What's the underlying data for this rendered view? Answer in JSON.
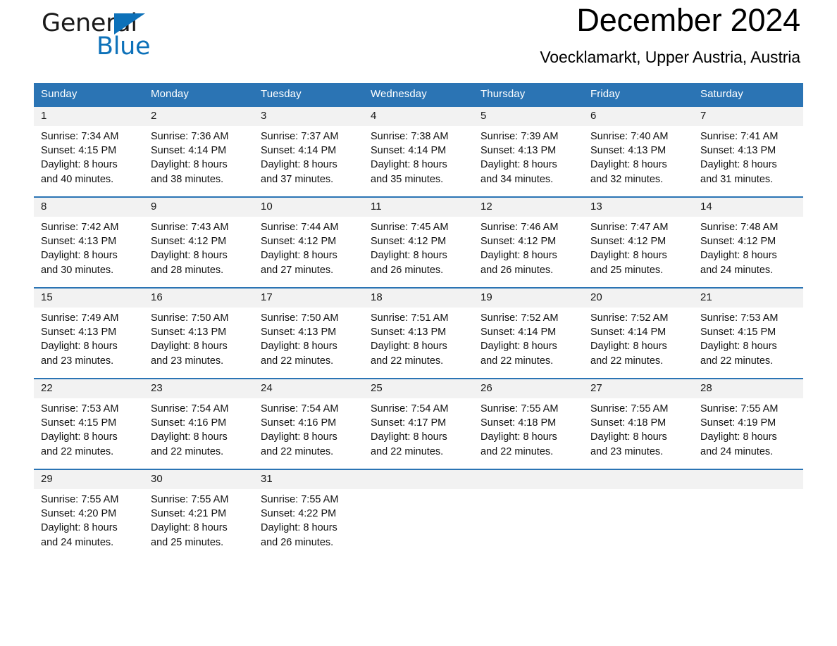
{
  "brand": {
    "name_part1": "General",
    "name_part2": "Blue",
    "triangle_icon": "triangle-icon",
    "accent_color": "#0d71b9"
  },
  "header": {
    "month_title": "December 2024",
    "location": "Voecklamarkt, Upper Austria, Austria"
  },
  "theme": {
    "header_blue": "#2b74b4",
    "daynum_band": "#f2f2f2",
    "page_background": "#ffffff",
    "text_color": "#111111"
  },
  "calendar": {
    "weekday_headers": [
      "Sunday",
      "Monday",
      "Tuesday",
      "Wednesday",
      "Thursday",
      "Friday",
      "Saturday"
    ],
    "weeks": [
      [
        {
          "day": "1",
          "sunrise": "Sunrise: 7:34 AM",
          "sunset": "Sunset: 4:15 PM",
          "daylight_line1": "Daylight: 8 hours",
          "daylight_line2": "and 40 minutes."
        },
        {
          "day": "2",
          "sunrise": "Sunrise: 7:36 AM",
          "sunset": "Sunset: 4:14 PM",
          "daylight_line1": "Daylight: 8 hours",
          "daylight_line2": "and 38 minutes."
        },
        {
          "day": "3",
          "sunrise": "Sunrise: 7:37 AM",
          "sunset": "Sunset: 4:14 PM",
          "daylight_line1": "Daylight: 8 hours",
          "daylight_line2": "and 37 minutes."
        },
        {
          "day": "4",
          "sunrise": "Sunrise: 7:38 AM",
          "sunset": "Sunset: 4:14 PM",
          "daylight_line1": "Daylight: 8 hours",
          "daylight_line2": "and 35 minutes."
        },
        {
          "day": "5",
          "sunrise": "Sunrise: 7:39 AM",
          "sunset": "Sunset: 4:13 PM",
          "daylight_line1": "Daylight: 8 hours",
          "daylight_line2": "and 34 minutes."
        },
        {
          "day": "6",
          "sunrise": "Sunrise: 7:40 AM",
          "sunset": "Sunset: 4:13 PM",
          "daylight_line1": "Daylight: 8 hours",
          "daylight_line2": "and 32 minutes."
        },
        {
          "day": "7",
          "sunrise": "Sunrise: 7:41 AM",
          "sunset": "Sunset: 4:13 PM",
          "daylight_line1": "Daylight: 8 hours",
          "daylight_line2": "and 31 minutes."
        }
      ],
      [
        {
          "day": "8",
          "sunrise": "Sunrise: 7:42 AM",
          "sunset": "Sunset: 4:13 PM",
          "daylight_line1": "Daylight: 8 hours",
          "daylight_line2": "and 30 minutes."
        },
        {
          "day": "9",
          "sunrise": "Sunrise: 7:43 AM",
          "sunset": "Sunset: 4:12 PM",
          "daylight_line1": "Daylight: 8 hours",
          "daylight_line2": "and 28 minutes."
        },
        {
          "day": "10",
          "sunrise": "Sunrise: 7:44 AM",
          "sunset": "Sunset: 4:12 PM",
          "daylight_line1": "Daylight: 8 hours",
          "daylight_line2": "and 27 minutes."
        },
        {
          "day": "11",
          "sunrise": "Sunrise: 7:45 AM",
          "sunset": "Sunset: 4:12 PM",
          "daylight_line1": "Daylight: 8 hours",
          "daylight_line2": "and 26 minutes."
        },
        {
          "day": "12",
          "sunrise": "Sunrise: 7:46 AM",
          "sunset": "Sunset: 4:12 PM",
          "daylight_line1": "Daylight: 8 hours",
          "daylight_line2": "and 26 minutes."
        },
        {
          "day": "13",
          "sunrise": "Sunrise: 7:47 AM",
          "sunset": "Sunset: 4:12 PM",
          "daylight_line1": "Daylight: 8 hours",
          "daylight_line2": "and 25 minutes."
        },
        {
          "day": "14",
          "sunrise": "Sunrise: 7:48 AM",
          "sunset": "Sunset: 4:12 PM",
          "daylight_line1": "Daylight: 8 hours",
          "daylight_line2": "and 24 minutes."
        }
      ],
      [
        {
          "day": "15",
          "sunrise": "Sunrise: 7:49 AM",
          "sunset": "Sunset: 4:13 PM",
          "daylight_line1": "Daylight: 8 hours",
          "daylight_line2": "and 23 minutes."
        },
        {
          "day": "16",
          "sunrise": "Sunrise: 7:50 AM",
          "sunset": "Sunset: 4:13 PM",
          "daylight_line1": "Daylight: 8 hours",
          "daylight_line2": "and 23 minutes."
        },
        {
          "day": "17",
          "sunrise": "Sunrise: 7:50 AM",
          "sunset": "Sunset: 4:13 PM",
          "daylight_line1": "Daylight: 8 hours",
          "daylight_line2": "and 22 minutes."
        },
        {
          "day": "18",
          "sunrise": "Sunrise: 7:51 AM",
          "sunset": "Sunset: 4:13 PM",
          "daylight_line1": "Daylight: 8 hours",
          "daylight_line2": "and 22 minutes."
        },
        {
          "day": "19",
          "sunrise": "Sunrise: 7:52 AM",
          "sunset": "Sunset: 4:14 PM",
          "daylight_line1": "Daylight: 8 hours",
          "daylight_line2": "and 22 minutes."
        },
        {
          "day": "20",
          "sunrise": "Sunrise: 7:52 AM",
          "sunset": "Sunset: 4:14 PM",
          "daylight_line1": "Daylight: 8 hours",
          "daylight_line2": "and 22 minutes."
        },
        {
          "day": "21",
          "sunrise": "Sunrise: 7:53 AM",
          "sunset": "Sunset: 4:15 PM",
          "daylight_line1": "Daylight: 8 hours",
          "daylight_line2": "and 22 minutes."
        }
      ],
      [
        {
          "day": "22",
          "sunrise": "Sunrise: 7:53 AM",
          "sunset": "Sunset: 4:15 PM",
          "daylight_line1": "Daylight: 8 hours",
          "daylight_line2": "and 22 minutes."
        },
        {
          "day": "23",
          "sunrise": "Sunrise: 7:54 AM",
          "sunset": "Sunset: 4:16 PM",
          "daylight_line1": "Daylight: 8 hours",
          "daylight_line2": "and 22 minutes."
        },
        {
          "day": "24",
          "sunrise": "Sunrise: 7:54 AM",
          "sunset": "Sunset: 4:16 PM",
          "daylight_line1": "Daylight: 8 hours",
          "daylight_line2": "and 22 minutes."
        },
        {
          "day": "25",
          "sunrise": "Sunrise: 7:54 AM",
          "sunset": "Sunset: 4:17 PM",
          "daylight_line1": "Daylight: 8 hours",
          "daylight_line2": "and 22 minutes."
        },
        {
          "day": "26",
          "sunrise": "Sunrise: 7:55 AM",
          "sunset": "Sunset: 4:18 PM",
          "daylight_line1": "Daylight: 8 hours",
          "daylight_line2": "and 22 minutes."
        },
        {
          "day": "27",
          "sunrise": "Sunrise: 7:55 AM",
          "sunset": "Sunset: 4:18 PM",
          "daylight_line1": "Daylight: 8 hours",
          "daylight_line2": "and 23 minutes."
        },
        {
          "day": "28",
          "sunrise": "Sunrise: 7:55 AM",
          "sunset": "Sunset: 4:19 PM",
          "daylight_line1": "Daylight: 8 hours",
          "daylight_line2": "and 24 minutes."
        }
      ],
      [
        {
          "day": "29",
          "sunrise": "Sunrise: 7:55 AM",
          "sunset": "Sunset: 4:20 PM",
          "daylight_line1": "Daylight: 8 hours",
          "daylight_line2": "and 24 minutes."
        },
        {
          "day": "30",
          "sunrise": "Sunrise: 7:55 AM",
          "sunset": "Sunset: 4:21 PM",
          "daylight_line1": "Daylight: 8 hours",
          "daylight_line2": "and 25 minutes."
        },
        {
          "day": "31",
          "sunrise": "Sunrise: 7:55 AM",
          "sunset": "Sunset: 4:22 PM",
          "daylight_line1": "Daylight: 8 hours",
          "daylight_line2": "and 26 minutes."
        },
        {
          "day": "",
          "sunrise": "",
          "sunset": "",
          "daylight_line1": "",
          "daylight_line2": ""
        },
        {
          "day": "",
          "sunrise": "",
          "sunset": "",
          "daylight_line1": "",
          "daylight_line2": ""
        },
        {
          "day": "",
          "sunrise": "",
          "sunset": "",
          "daylight_line1": "",
          "daylight_line2": ""
        },
        {
          "day": "",
          "sunrise": "",
          "sunset": "",
          "daylight_line1": "",
          "daylight_line2": ""
        }
      ]
    ]
  }
}
